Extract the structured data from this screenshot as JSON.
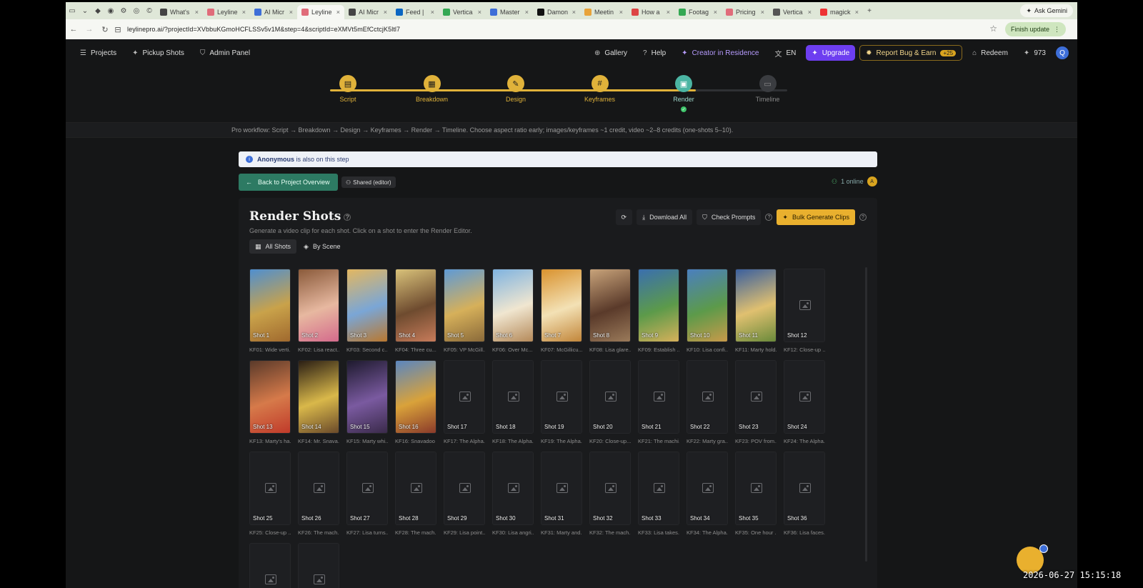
{
  "browser": {
    "tabs": [
      {
        "label": "What's",
        "color": "#444"
      },
      {
        "label": "Leyline",
        "color": "#e06c7a"
      },
      {
        "label": "AI Micr",
        "color": "#3d6ed8"
      },
      {
        "label": "Leyline",
        "color": "#e06c7a",
        "active": true
      },
      {
        "label": "AI Micr",
        "color": "#444"
      },
      {
        "label": "Feed |",
        "color": "#0a66c2"
      },
      {
        "label": "Vertica",
        "color": "#34a853"
      },
      {
        "label": "Master",
        "color": "#3d6ed8"
      },
      {
        "label": "Damon",
        "color": "#111"
      },
      {
        "label": "Meetin",
        "color": "#e8a33a"
      },
      {
        "label": "How a",
        "color": "#d44"
      },
      {
        "label": "Footag",
        "color": "#34a853"
      },
      {
        "label": "Pricing",
        "color": "#e06c7a"
      },
      {
        "label": "Vertica",
        "color": "#555"
      },
      {
        "label": "magick",
        "color": "#e33"
      }
    ],
    "ask_label": "Ask Gemini",
    "url": "leylinepro.ai/?projectId=XVbbuKGmoHCFLSSv5v1M&step=4&scriptId=eXMVt5mEfCctcjK5ltl7",
    "finish_label": "Finish update",
    "profile_initial": "Q"
  },
  "header": {
    "projects": "Projects",
    "pickup": "Pickup Shots",
    "admin": "Admin Panel",
    "gallery": "Gallery",
    "help": "Help",
    "creator": "Creator in Residence",
    "lang": "EN",
    "upgrade": "Upgrade",
    "report": "Report Bug & Earn",
    "report_badge": "+25",
    "redeem": "Redeem",
    "credits": "973",
    "avatar": "Q"
  },
  "stepper": {
    "steps": [
      {
        "label": "Script",
        "icon": "▤",
        "state": "done"
      },
      {
        "label": "Breakdown",
        "icon": "▦",
        "state": "done"
      },
      {
        "label": "Design",
        "icon": "✎",
        "state": "done"
      },
      {
        "label": "Keyframes",
        "icon": "#",
        "state": "done"
      },
      {
        "label": "Render",
        "icon": "▣",
        "state": "current"
      },
      {
        "label": "Timeline",
        "icon": "▭",
        "state": "future"
      }
    ],
    "progress": 0.8
  },
  "workflow_text": "Pro workflow: Script → Breakdown → Design → Keyframes → Render → Timeline. Choose aspect ratio early; images/keyframes ~1 credit, video ~2–8 credits (one-shots 5–10).",
  "presence": {
    "user": "Anonymous",
    "text": " is also on this step"
  },
  "back_label": "Back to Project Overview",
  "shared_label": "Shared (editor)",
  "online_label": "1 online",
  "online_initial": "A",
  "panel": {
    "title": "Render Shots",
    "subtitle": "Generate a video clip for each shot. Click on a shot to enter the Render Editor.",
    "download_all": "Download All",
    "check_prompts": "Check Prompts",
    "bulk_generate": "Bulk Generate Clips",
    "tab_all": "All Shots",
    "tab_scene": "By Scene"
  },
  "shots": [
    {
      "num": "Shot 1",
      "cap": "KF01: Wide verti...",
      "img": [
        "#4f8fd0",
        "#c9a24a",
        "#a0692e"
      ]
    },
    {
      "num": "Shot 2",
      "cap": "KF02: Lisa react...",
      "img": [
        "#8a5a3a",
        "#e7b8a0",
        "#d46a8c"
      ]
    },
    {
      "num": "Shot 3",
      "cap": "KF03: Second c...",
      "img": [
        "#e3b760",
        "#7aa6d6",
        "#b9782f"
      ]
    },
    {
      "num": "Shot 4",
      "cap": "KF04: Three cu...",
      "img": [
        "#d9c27a",
        "#6e4b2f",
        "#c77b5a"
      ]
    },
    {
      "num": "Shot 5",
      "cap": "KF05: VP McGill...",
      "img": [
        "#5e9ad6",
        "#d6b05a",
        "#8a6a3a"
      ]
    },
    {
      "num": "Shot 6",
      "cap": "KF06: Over Mc...",
      "img": [
        "#7fb3e0",
        "#f0e6d0",
        "#b58a5a"
      ]
    },
    {
      "num": "Shot 7",
      "cap": "KF07: McGillicu...",
      "img": [
        "#d9922e",
        "#f3e1b5",
        "#c2863a"
      ]
    },
    {
      "num": "Shot 8",
      "cap": "KF08: Lisa glare...",
      "img": [
        "#c8a37a",
        "#5a3a2a",
        "#9a7a5a"
      ]
    },
    {
      "num": "Shot 9",
      "cap": "KF09: Establish ...",
      "img": [
        "#3a6fae",
        "#5c9a4a",
        "#d6b05a"
      ]
    },
    {
      "num": "Shot 10",
      "cap": "KF10: Lisa confi...",
      "img": [
        "#4a7fbf",
        "#5c9a4a",
        "#c89a4a"
      ]
    },
    {
      "num": "Shot 11",
      "cap": "KF11: Marty hold...",
      "img": [
        "#3a5f9e",
        "#e0c070",
        "#6a8a3a"
      ]
    },
    {
      "num": "Shot 12",
      "cap": "KF12: Close-up ...",
      "img": null
    },
    {
      "num": "Shot 13",
      "cap": "KF13: Marty's ha...",
      "img": [
        "#5a3a2a",
        "#d67a4a",
        "#c03a2a"
      ]
    },
    {
      "num": "Shot 14",
      "cap": "KF14: Mr. Snava...",
      "img": [
        "#2a1e14",
        "#d9b84a",
        "#6a4a2a"
      ]
    },
    {
      "num": "Shot 15",
      "cap": "KF15: Marty whi...",
      "img": [
        "#1e1a2e",
        "#7a5aa0",
        "#3a2a4a"
      ]
    },
    {
      "num": "Shot 16",
      "cap": "KF16: Snavadoo ...",
      "img": [
        "#5a86c0",
        "#d9a23a",
        "#8a3a2a"
      ]
    },
    {
      "num": "Shot 17",
      "cap": "KF17: The Alpha...",
      "img": null
    },
    {
      "num": "Shot 18",
      "cap": "KF18: The Alpha...",
      "img": null
    },
    {
      "num": "Shot 19",
      "cap": "KF19: The Alpha...",
      "img": null
    },
    {
      "num": "Shot 20",
      "cap": "KF20: Close-up...",
      "img": null
    },
    {
      "num": "Shot 21",
      "cap": "KF21: The machi...",
      "img": null
    },
    {
      "num": "Shot 22",
      "cap": "KF22: Marty gra...",
      "img": null
    },
    {
      "num": "Shot 23",
      "cap": "KF23: POV from...",
      "img": null
    },
    {
      "num": "Shot 24",
      "cap": "KF24: The Alpha...",
      "img": null
    },
    {
      "num": "Shot 25",
      "cap": "KF25: Close-up ...",
      "img": null
    },
    {
      "num": "Shot 26",
      "cap": "KF26: The mach...",
      "img": null
    },
    {
      "num": "Shot 27",
      "cap": "KF27: Lisa turns...",
      "img": null
    },
    {
      "num": "Shot 28",
      "cap": "KF28: The mach...",
      "img": null
    },
    {
      "num": "Shot 29",
      "cap": "KF29: Lisa point...",
      "img": null
    },
    {
      "num": "Shot 30",
      "cap": "KF30: Lisa angri...",
      "img": null
    },
    {
      "num": "Shot 31",
      "cap": "KF31: Marty and...",
      "img": null
    },
    {
      "num": "Shot 32",
      "cap": "KF32: The mach...",
      "img": null
    },
    {
      "num": "Shot 33",
      "cap": "KF33: Lisa takes...",
      "img": null
    },
    {
      "num": "Shot 34",
      "cap": "KF34: The Alpha...",
      "img": null
    },
    {
      "num": "Shot 35",
      "cap": "KF35: One hour ...",
      "img": null
    },
    {
      "num": "Shot 36",
      "cap": "KF36: Lisa faces...",
      "img": null
    },
    {
      "num": "",
      "cap": "",
      "img": null
    },
    {
      "num": "",
      "cap": "",
      "img": null
    }
  ],
  "clock": "2026-06-27  15:15:18"
}
